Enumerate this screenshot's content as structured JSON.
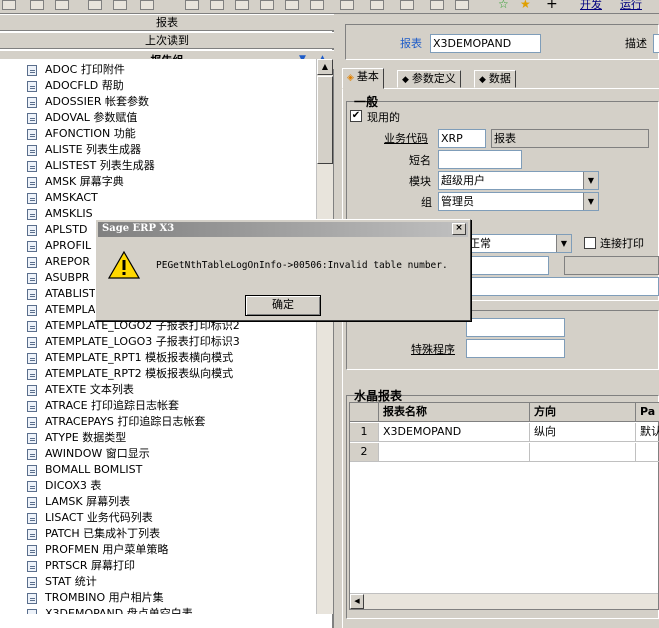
{
  "left_panel": {
    "header1": "报表",
    "header2": "上次读到",
    "header3": "报告组",
    "items": [
      "ADOC 打印附件",
      "ADOCFLD 帮助",
      "ADOSSIER 帐套参数",
      "ADOVAL 参数赋值",
      "AFONCTION 功能",
      "ALISTE 列表生成器",
      "ALISTEST 列表生成器",
      "AMSK 屏幕字典",
      "AMSKACT",
      "AMSKLIS",
      "APLSTD",
      "APROFIL",
      "AREPOR",
      "ASUBPR",
      "ATABLIST",
      "ATEMPLA",
      "ATEMPLATE_LOGO2 子报表打印标识2",
      "ATEMPLATE_LOGO3 子报表打印标识3",
      "ATEMPLATE_RPT1 模板报表横向模式",
      "ATEMPLATE_RPT2 模板报表纵向模式",
      "ATEXTE 文本列表",
      "ATRACE 打印追踪日志帐套",
      "ATRACEPAYS 打印追踪日志帐套",
      "ATYPE 数据类型",
      "AWINDOW 窗口显示",
      "BOMALL BOMLIST",
      "DICOX3 表",
      "LAMSK 屏幕列表",
      "LISACT 业务代码列表",
      "PATCH 已集成补丁列表",
      "PROFMEN 用户菜单策略",
      "PRTSCR 屏幕打印",
      "STAT 统计",
      "TROMBINO 用户相片集",
      "X3DEMOPAND 盘点单空白表"
    ]
  },
  "toolbar": {
    "link1": "开发",
    "link2": "运行"
  },
  "form": {
    "report_label": "报表",
    "report_value": "X3DEMOPAND",
    "desc_label": "描述",
    "tabs": [
      "基本",
      "参数定义",
      "数据"
    ],
    "section_general": "一般",
    "active_label": "现用的",
    "active_checked": "✔",
    "bizcode_label": "业务代码",
    "bizcode_value": "XRP",
    "bizcode_desc": "报表",
    "short_label": "短名",
    "short_value": "",
    "module_label": "模块",
    "module_value": "超级用户",
    "group_label": "组",
    "group_value": "管理员",
    "mode_value": "正常",
    "connect_print_label": "连接打印",
    "special_prog_label": "特殊程序",
    "crystal_section": "水晶报表",
    "grid_headers": [
      "报表名称",
      "方向",
      "Pa"
    ],
    "grid_rows": [
      {
        "num": "1",
        "name": "X3DEMOPAND",
        "dir": "纵向",
        "pa": "默认"
      },
      {
        "num": "2",
        "name": "",
        "dir": "",
        "pa": ""
      }
    ]
  },
  "dialog": {
    "title": "Sage ERP X3",
    "message": "PEGetNthTableLogOnInfo->00506:Invalid table number.",
    "ok_label": "确定",
    "close_glyph": "×"
  }
}
